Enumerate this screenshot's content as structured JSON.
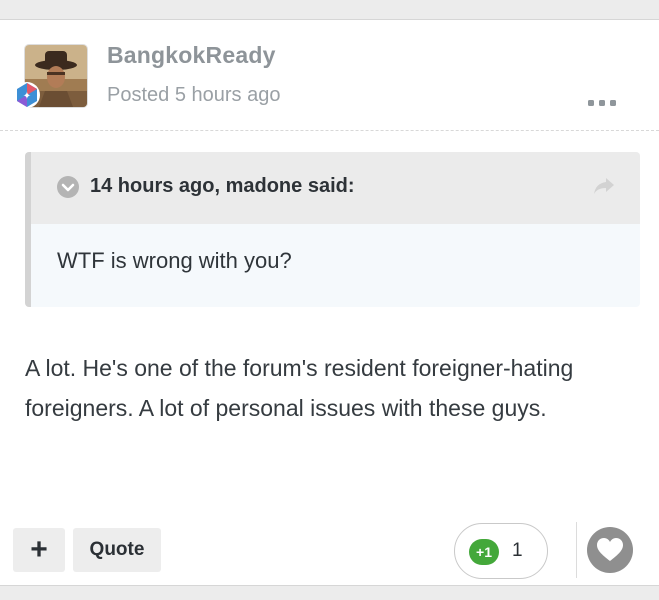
{
  "post": {
    "author": "BangkokReady",
    "posted": "Posted 5 hours ago",
    "quote": {
      "cite": "14 hours ago, madone said:",
      "text": "WTF is wrong with you?"
    },
    "body": "A lot.  He's one of the forum's resident foreigner-hating foreigners.  A lot of personal issues with these guys."
  },
  "footer": {
    "plus_label": "+",
    "quote_label": "Quote",
    "reaction_badge": "+1",
    "reaction_count": "1"
  },
  "icons": {
    "menu": "ellipsis-icon",
    "toggle": "chevron-down-circle-icon",
    "share": "share-arrow-icon",
    "like": "heart-icon",
    "rank": "rank-badge-icon"
  },
  "colors": {
    "reaction_green": "#44a83a",
    "heart_gray": "#8f8f8f",
    "username_gray": "#8e9499"
  }
}
